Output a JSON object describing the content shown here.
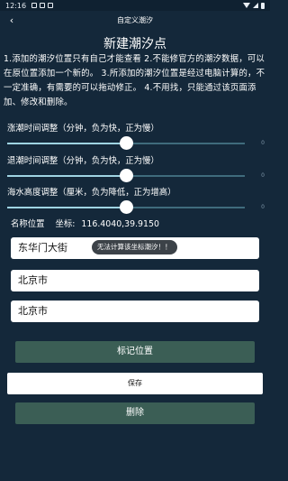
{
  "status_bar": {
    "time": "12:16"
  },
  "toolbar": {
    "title": "自定义潮汐",
    "back_icon": "back-chevron-icon"
  },
  "heading": "新建潮汐点",
  "description": "1.添加的潮汐位置只有自己才能查看 2.不能修官方的潮汐数据，可以在原位置添加一个新的。 3.所添加的潮汐位置是经过电脑计算的，不一定准确，有需要的可以拖动修正。 4.不用找，只能通过该页面添加、修改和删除。",
  "sliders": [
    {
      "label": "涨潮时间调整（分钟，负为快，正为慢）",
      "value": "0",
      "level": 0.5
    },
    {
      "label": "退潮时间调整（分钟，负为快，正为慢）",
      "value": "0",
      "level": 0.5
    },
    {
      "label": "海水高度调整（厘米，负为降低，正为增高）",
      "value": "0",
      "level": 0.5
    }
  ],
  "coords": {
    "name_label": "名称位置",
    "coord_label": "坐标:",
    "coord_value": "116.4040,39.9150"
  },
  "fields": [
    {
      "value": "东华门大街"
    },
    {
      "value": "北京市"
    },
    {
      "value": "北京市"
    }
  ],
  "toast": "无法计算该坐标潮汐！！",
  "buttons": {
    "mark_location": "标记位置",
    "save": "保存",
    "delete": "删除"
  },
  "colors": {
    "background": "#14283a",
    "button_dark": "#3b5e55",
    "slider_active": "#9fd4e3"
  }
}
